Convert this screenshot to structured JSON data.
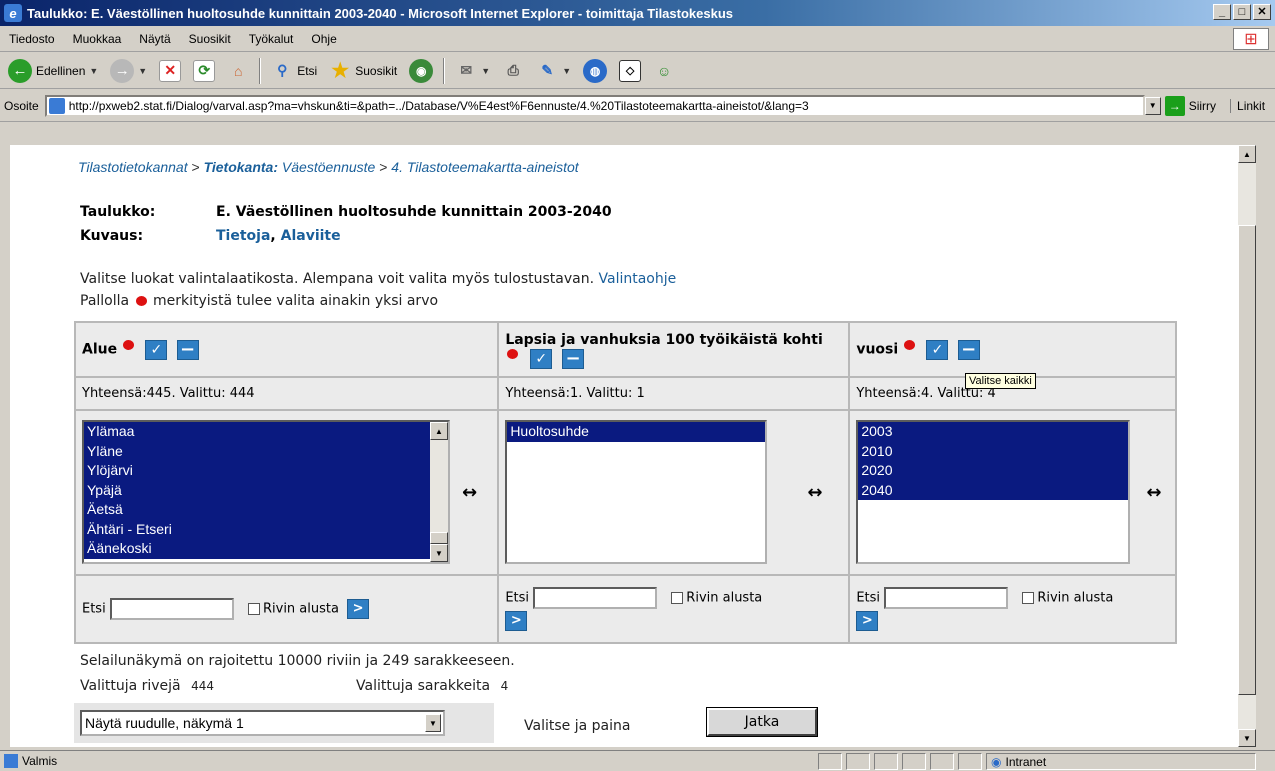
{
  "window": {
    "title": "Taulukko: E. Väestöllinen huoltosuhde kunnittain 2003-2040 - Microsoft Internet Explorer - toimittaja Tilastokeskus"
  },
  "menu": [
    "Tiedosto",
    "Muokkaa",
    "Näytä",
    "Suosikit",
    "Työkalut",
    "Ohje"
  ],
  "toolbar": {
    "back": "Edellinen",
    "search": "Etsi",
    "favorites": "Suosikit"
  },
  "address": {
    "label": "Osoite",
    "url": "http://pxweb2.stat.fi/Dialog/varval.asp?ma=vhskun&ti=&path=../Database/V%E4est%F6ennuste/4.%20Tilastoteemakartta-aineistot/&lang=3",
    "go": "Siirry",
    "links": "Linkit"
  },
  "breadcrumb": {
    "part1": "Tilastotietokannat",
    "sep1": " > ",
    "part2_bold": "Tietokanta:",
    "part2": " Väestöennuste",
    "sep2": " > ",
    "part3": "4. Tilastoteemakartta-aineistot"
  },
  "table_info": {
    "label": "Taulukko:",
    "value": "E. Väestöllinen huoltosuhde kunnittain 2003-2040",
    "desc_label": "Kuvaus:",
    "link1": "Tietoja",
    "comma": ",",
    "link2": "Alaviite"
  },
  "intro": {
    "line1": "Valitse luokat valintalaatikosta. Alempana voit valita myös tulostustavan.",
    "help_link": "Valintaohje",
    "line2a": "Pallolla",
    "line2b": "merkityistä tulee valita ainakin yksi arvo"
  },
  "variables": [
    {
      "title": "Alue",
      "summary": "Yhteensä:445. Valittu: 444",
      "items": [
        "Ylämaa",
        "Yläne",
        "Ylöjärvi",
        "Ypäjä",
        "Äetsä",
        "Ähtäri - Etseri",
        "Äänekoski"
      ]
    },
    {
      "title": "Lapsia ja vanhuksia 100 työikäistä kohti",
      "summary": "Yhteensä:1. Valittu: 1",
      "items": [
        "Huoltosuhde"
      ]
    },
    {
      "title": "vuosi",
      "summary": "Yhteensä:4. Valittu: 4",
      "items": [
        "2003",
        "2010",
        "2020",
        "2040"
      ]
    }
  ],
  "search": {
    "label": "Etsi",
    "checkbox": "Rivin alusta"
  },
  "tooltip": "Valitse kaikki",
  "limits": {
    "text": "Selailunäkymä on rajoitettu 10000 riviin ja 249 sarakkeeseen.",
    "rows_label": "Valittuja rivejä",
    "rows_value": "444",
    "cols_label": "Valittuja sarakkeita",
    "cols_value": "4"
  },
  "output": {
    "selected": "Näytä ruudulle, näkymä 1",
    "prompt": "Valitse ja paina",
    "button": "Jatka"
  },
  "status": {
    "text": "Valmis",
    "zone": "Intranet"
  }
}
